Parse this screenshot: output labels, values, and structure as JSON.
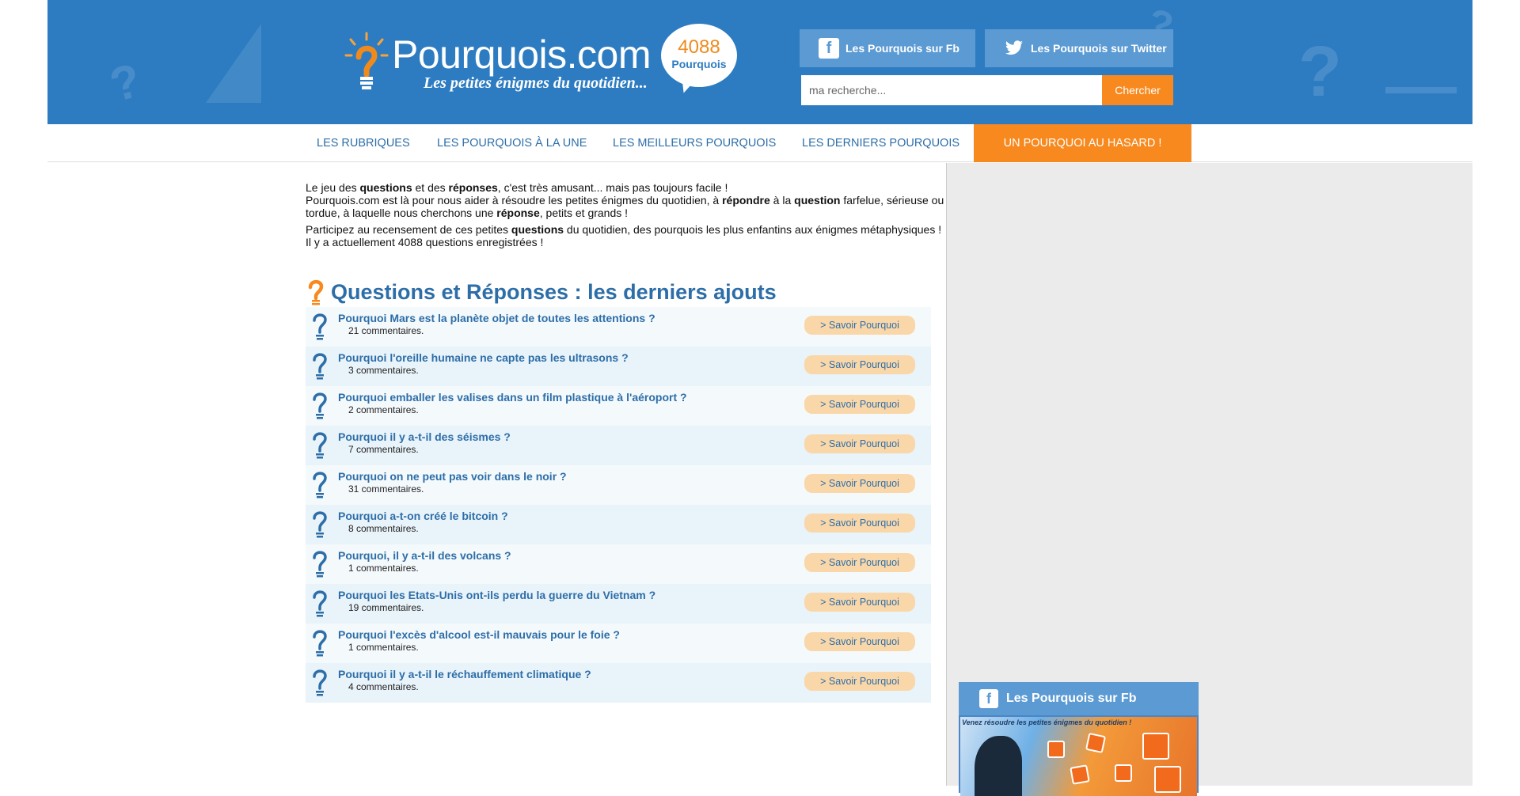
{
  "header": {
    "site_name": "Pourquois.com",
    "tagline": "Les petites énigmes du quotidien...",
    "counter_value": "4088",
    "counter_label": "Pourquois",
    "facebook_label": "Les Pourquois sur Fb",
    "twitter_label": "Les Pourquois sur Twitter",
    "search_placeholder": "ma recherche...",
    "search_button": "Chercher"
  },
  "nav": {
    "items": [
      {
        "label": "LES RUBRIQUES"
      },
      {
        "label": "LES POURQUOIS À LA UNE"
      },
      {
        "label": "LES MEILLEURS POURQUOIS"
      },
      {
        "label": "LES DERNIERS POURQUOIS"
      },
      {
        "label": "UN POURQUOI AU HASARD !"
      }
    ]
  },
  "intro": {
    "p1_a": "Le jeu des ",
    "p1_b": "questions",
    "p1_c": " et des ",
    "p1_d": "réponses",
    "p1_e": ", c'est très amusant... mais pas toujours facile !",
    "p2_a": "Pourquois.com est là pour nous aider à résoudre les petites énigmes du quotidien, à ",
    "p2_b": "répondre",
    "p2_c": " à la ",
    "p2_d": "question",
    "p2_e": " farfelue, sérieuse ou tordue, à laquelle nous cherchons une ",
    "p2_f": "réponse",
    "p2_g": ", petits et grands !",
    "p3_a": "Participez au recensement de ces petites ",
    "p3_b": "questions",
    "p3_c": " du quotidien, des pourquois les plus enfantins aux énigmes métaphysiques ! Il y a actuellement 4088 questions enregistrées !"
  },
  "section_title": "Questions et Réponses : les derniers ajouts",
  "questions": [
    {
      "title": "Pourquoi Mars est la planète objet de toutes les attentions ?",
      "comments": "21 commentaires.",
      "button": "> Savoir Pourquoi"
    },
    {
      "title": "Pourquoi l'oreille humaine ne capte pas les ultrasons ?",
      "comments": "3 commentaires.",
      "button": "> Savoir Pourquoi"
    },
    {
      "title": "Pourquoi emballer les valises dans un film plastique à l'aéroport ?",
      "comments": "2 commentaires.",
      "button": "> Savoir Pourquoi"
    },
    {
      "title": "Pourquoi il y a-t-il des séismes ?",
      "comments": "7 commentaires.",
      "button": "> Savoir Pourquoi"
    },
    {
      "title": "Pourquoi on ne peut pas voir dans le noir ?",
      "comments": "31 commentaires.",
      "button": "> Savoir Pourquoi"
    },
    {
      "title": "Pourquoi a-t-on créé le bitcoin ?",
      "comments": "8 commentaires.",
      "button": "> Savoir Pourquoi"
    },
    {
      "title": "Pourquoi, il y a-t-il des volcans ?",
      "comments": "1 commentaires.",
      "button": "> Savoir Pourquoi"
    },
    {
      "title": "Pourquoi les Etats-Unis ont-ils perdu la guerre du Vietnam ?",
      "comments": "19 commentaires.",
      "button": "> Savoir Pourquoi"
    },
    {
      "title": "Pourquoi l'excès d'alcool est-il mauvais pour le foie ?",
      "comments": "1 commentaires.",
      "button": "> Savoir Pourquoi"
    },
    {
      "title": "Pourquoi il y a-t-il le réchauffement climatique ?",
      "comments": "4 commentaires.",
      "button": "> Savoir Pourquoi"
    }
  ],
  "sidebar": {
    "fb_title": "Les Pourquois sur Fb",
    "fb_caption": "Venez résoudre les petites énigmes du quotidien !"
  },
  "colors": {
    "header_blue": "#2d7cc1",
    "accent_orange": "#f7891f",
    "link_blue": "#2d6ea8",
    "button_peach": "#fad7a9"
  }
}
